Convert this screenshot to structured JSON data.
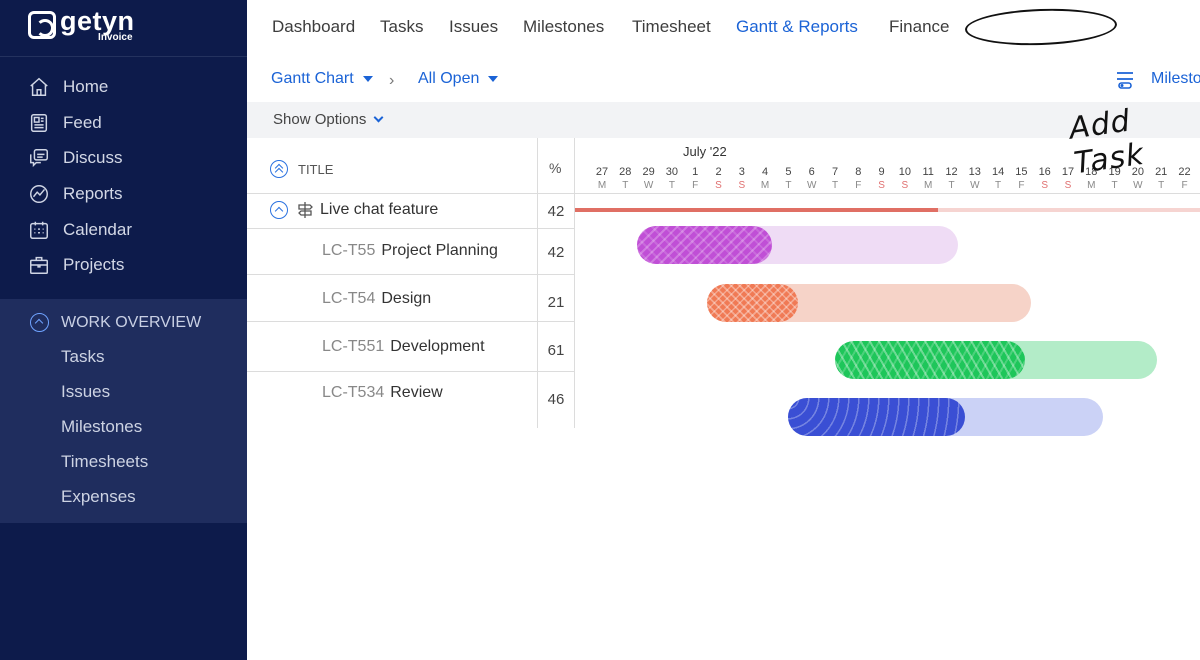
{
  "brand": {
    "name": "getyn",
    "sub": "Invoice"
  },
  "sidebar": {
    "items": [
      {
        "label": "Home",
        "icon": "home-icon"
      },
      {
        "label": "Feed",
        "icon": "feed-icon"
      },
      {
        "label": "Discuss",
        "icon": "discuss-icon"
      },
      {
        "label": "Reports",
        "icon": "reports-icon"
      },
      {
        "label": "Calendar",
        "icon": "calendar-icon"
      },
      {
        "label": "Projects",
        "icon": "projects-icon"
      }
    ],
    "work_overview": {
      "title": "WORK OVERVIEW",
      "items": [
        "Tasks",
        "Issues",
        "Milestones",
        "Timesheets",
        "Expenses"
      ]
    }
  },
  "topnav": {
    "tabs": [
      "Dashboard",
      "Tasks",
      "Issues",
      "Milestones",
      "Timesheet",
      "Gantt & Reports",
      "Finance"
    ],
    "active": "Gantt & Reports"
  },
  "subbar": {
    "view": "Gantt Chart",
    "filter": "All Open",
    "right": "Milesto"
  },
  "options": {
    "label": "Show Options"
  },
  "grid": {
    "title_header": "TITLE",
    "pct_header": "%",
    "parent": {
      "title": "Live chat feature",
      "pct": "42"
    },
    "rows": [
      {
        "code": "LC-T55",
        "title": "Project Planning",
        "pct": "42"
      },
      {
        "code": "LC-T54",
        "title": "Design",
        "pct": "21"
      },
      {
        "code": "LC-T551",
        "title": "Development",
        "pct": "61"
      },
      {
        "code": "LC-T534",
        "title": "Review",
        "pct": "46"
      }
    ]
  },
  "timeline": {
    "month": "July '22",
    "days": [
      "27",
      "28",
      "29",
      "30",
      "1",
      "2",
      "3",
      "4",
      "5",
      "6",
      "7",
      "8",
      "9",
      "10",
      "11",
      "12",
      "13",
      "14",
      "15",
      "16",
      "17",
      "18",
      "19",
      "20",
      "21",
      "22"
    ],
    "dows": [
      "M",
      "T",
      "W",
      "T",
      "F",
      "S",
      "S",
      "M",
      "T",
      "W",
      "T",
      "F",
      "S",
      "S",
      "M",
      "T",
      "W",
      "T",
      "F",
      "S",
      "S",
      "M",
      "T",
      "W",
      "T",
      "F"
    ]
  },
  "bars": [
    {
      "color": "#c04fd6",
      "light": "#efdcf5",
      "start_day": 1.5,
      "end_day": 15.3,
      "progress": 0.42
    },
    {
      "color": "#f07a55",
      "light": "#f6d3c8",
      "start_day": 4.5,
      "end_day": 18.4,
      "progress": 0.28
    },
    {
      "color": "#1ec65a",
      "light": "#b3ecc8",
      "start_day": 10.0,
      "end_day": 23.8,
      "progress": 0.59
    },
    {
      "color": "#3a4fd4",
      "light": "#cbd2f6",
      "start_day": 8.0,
      "end_day": 21.5,
      "progress": 0.56
    }
  ],
  "summary": {
    "color": "#e06f64",
    "light": "#f6d4d1",
    "progress_end_day": 14.4
  },
  "annotation": {
    "text": "Add Task"
  }
}
